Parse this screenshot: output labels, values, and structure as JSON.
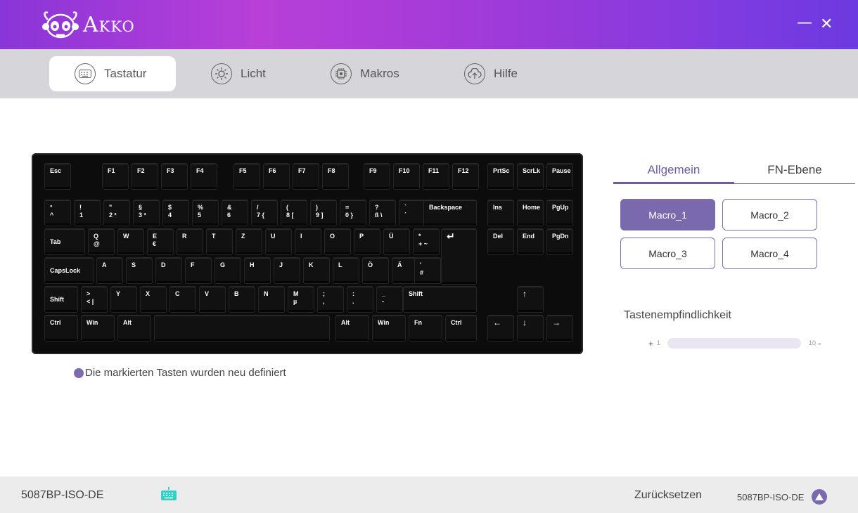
{
  "app": {
    "logo_text": "Akko",
    "minimize": "—",
    "close": "✕"
  },
  "tabs": [
    {
      "label": "Tastatur",
      "icon": "keyboard-icon",
      "active": true
    },
    {
      "label": "Licht",
      "icon": "sun-icon",
      "active": false
    },
    {
      "label": "Makros",
      "icon": "chip-icon",
      "active": false
    },
    {
      "label": "Hilfe",
      "icon": "cloud-upload-icon",
      "active": false
    }
  ],
  "keyboard": {
    "fn_row": [
      "Esc",
      "F1",
      "F2",
      "F3",
      "F4",
      "F5",
      "F6",
      "F7",
      "F8",
      "F9",
      "F10",
      "F11",
      "F12",
      "PrtSc",
      "ScrLk",
      "Pause"
    ],
    "num_row": [
      [
        "°",
        "^"
      ],
      [
        "!",
        "1"
      ],
      [
        "\"",
        "2 ²"
      ],
      [
        "§",
        "3 ³"
      ],
      [
        "$",
        "4"
      ],
      [
        "%",
        "5"
      ],
      [
        "&",
        "6"
      ],
      [
        "/",
        "7 {"
      ],
      [
        "(",
        "8 ["
      ],
      [
        ")",
        "9 ]"
      ],
      [
        "=",
        "0 }"
      ],
      [
        "?",
        "ß \\"
      ],
      [
        "`",
        "´"
      ],
      [
        "Backspace",
        ""
      ]
    ],
    "nav_row1": [
      "Ins",
      "Home",
      "PgUp"
    ],
    "q_row": [
      [
        "Tab",
        ""
      ],
      [
        "Q",
        "@"
      ],
      [
        "W",
        ""
      ],
      [
        "E",
        "€"
      ],
      [
        "R",
        ""
      ],
      [
        "T",
        ""
      ],
      [
        "Z",
        ""
      ],
      [
        "U",
        ""
      ],
      [
        "I",
        ""
      ],
      [
        "O",
        ""
      ],
      [
        "P",
        ""
      ],
      [
        "Ü",
        ""
      ],
      [
        "*",
        "+ ~"
      ]
    ],
    "nav_row2": [
      "Del",
      "End",
      "PgDn"
    ],
    "a_row": [
      [
        "CapsLock",
        ""
      ],
      [
        "A",
        ""
      ],
      [
        "S",
        ""
      ],
      [
        "D",
        ""
      ],
      [
        "F",
        ""
      ],
      [
        "G",
        ""
      ],
      [
        "H",
        ""
      ],
      [
        "J",
        ""
      ],
      [
        "K",
        ""
      ],
      [
        "L",
        ""
      ],
      [
        "Ö",
        ""
      ],
      [
        "Ä",
        ""
      ],
      [
        "'",
        "#"
      ]
    ],
    "z_row": [
      [
        "Shift",
        ""
      ],
      [
        ">",
        "< |"
      ],
      [
        "Y",
        ""
      ],
      [
        "X",
        ""
      ],
      [
        "C",
        ""
      ],
      [
        "V",
        ""
      ],
      [
        "B",
        ""
      ],
      [
        "N",
        ""
      ],
      [
        "M",
        "µ"
      ],
      [
        ";",
        ","
      ],
      [
        ":",
        "."
      ],
      [
        "_",
        "-"
      ],
      [
        "Shift",
        ""
      ]
    ],
    "bottom_row": [
      "Ctrl",
      "Win",
      "Alt",
      "",
      "Alt",
      "Win",
      "Fn",
      "Ctrl"
    ],
    "arrows": [
      "↑",
      "←",
      "↓",
      "→"
    ]
  },
  "legend_text": "Die markierten Tasten wurden neu definiert",
  "side_tabs": [
    {
      "label": "Allgemein",
      "active": true
    },
    {
      "label": "FN-Ebene",
      "active": false
    }
  ],
  "macros": [
    "Macro_1",
    "Macro_2",
    "Macro_3",
    "Macro_4"
  ],
  "sensitivity": {
    "label": "Tastenempfindlichkeit",
    "plus": "+",
    "min": "1",
    "max": "10",
    "minus": "-",
    "value": 1
  },
  "footer": {
    "model": "5087BP-ISO-DE",
    "reset": "Zurücksetzen",
    "model_right": "5087BP-ISO-DE"
  },
  "colors": {
    "accent": "#7a6aad",
    "title_gradient_start": "#8a35d8",
    "title_gradient_end": "#6b3ae0",
    "keyboard_icon": "#2fd3c5"
  }
}
